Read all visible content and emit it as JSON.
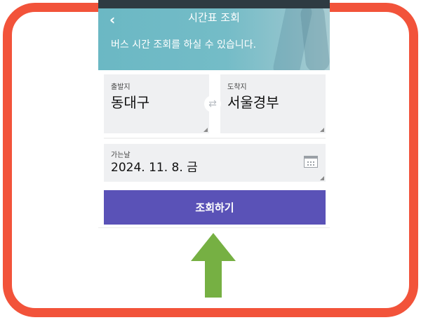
{
  "header": {
    "back_icon": "‹",
    "title": "시간표 조회",
    "subtitle": "버스 시간 조회를 하실 수 있습니다."
  },
  "route": {
    "from_label": "출발지",
    "from_value": "동대구",
    "swap_icon": "⇄",
    "to_label": "도착지",
    "to_value": "서울경부"
  },
  "date": {
    "label": "가는날",
    "value": "2024. 11. 8. 금"
  },
  "search_button_label": "조회하기",
  "colors": {
    "frame": "#f2533a",
    "button": "#5a52b7",
    "arrow": "#76b043",
    "header": "#74bcc7"
  },
  "icons": [
    "chevron-left-icon",
    "swap-icon",
    "calendar-icon",
    "arrow-up-icon"
  ]
}
